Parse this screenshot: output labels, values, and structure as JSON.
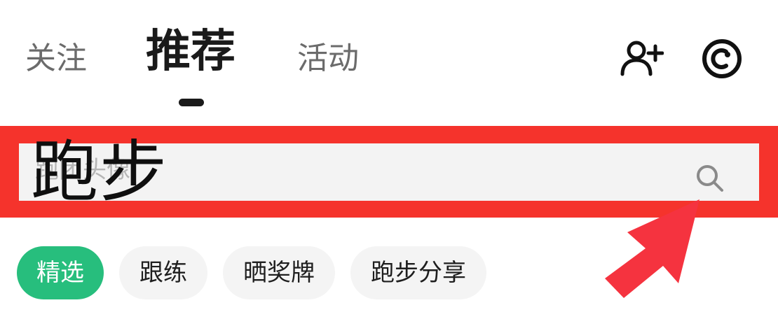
{
  "tabs": {
    "follow": "关注",
    "recommend": "推荐",
    "activity": "活动"
  },
  "header_icons": {
    "add_friend": "add-user-icon",
    "circle": "circle-c-icon"
  },
  "search": {
    "placeholder": "跑团头像",
    "overlay_text": "跑步",
    "icon": "search-icon"
  },
  "chips": [
    {
      "label": "精选",
      "selected": true
    },
    {
      "label": "跟练",
      "selected": false
    },
    {
      "label": "晒奖牌",
      "selected": false
    },
    {
      "label": "跑步分享",
      "selected": false
    }
  ],
  "colors": {
    "highlight": "#f5332c",
    "arrow": "#f5333f",
    "chip_selected": "#27be7d",
    "chip_default": "#f4f4f4",
    "search_bg": "#f3f3f3"
  }
}
